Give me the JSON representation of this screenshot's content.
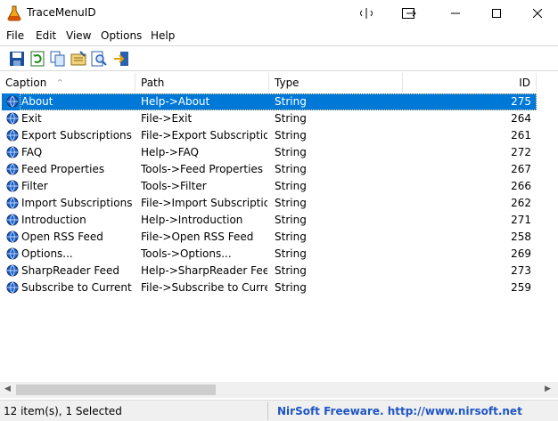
{
  "window": {
    "title": "TraceMenuID",
    "icon": "flask-icon"
  },
  "menubar": [
    "File",
    "Edit",
    "View",
    "Options",
    "Help"
  ],
  "toolbar": [
    "save-icon",
    "refresh-icon",
    "copy-icon",
    "properties-icon",
    "find-icon",
    "exit-icon"
  ],
  "columns": [
    "Caption",
    "Path",
    "Type",
    "ID"
  ],
  "rows": [
    {
      "caption": "About",
      "path": "Help->About",
      "type": "String",
      "id": "275",
      "selected": true
    },
    {
      "caption": "Exit",
      "path": "File->Exit",
      "type": "String",
      "id": "264"
    },
    {
      "caption": "Export Subscriptions",
      "path": "File->Export Subscriptio...",
      "type": "String",
      "id": "261"
    },
    {
      "caption": "FAQ",
      "path": "Help->FAQ",
      "type": "String",
      "id": "272"
    },
    {
      "caption": "Feed Properties",
      "path": "Tools->Feed Properties",
      "type": "String",
      "id": "267"
    },
    {
      "caption": "Filter",
      "path": "Tools->Filter",
      "type": "String",
      "id": "266"
    },
    {
      "caption": "Import Subscriptions",
      "path": "File->Import Subscriptio...",
      "type": "String",
      "id": "262"
    },
    {
      "caption": "Introduction",
      "path": "Help->Introduction",
      "type": "String",
      "id": "271"
    },
    {
      "caption": "Open RSS Feed",
      "path": "File->Open RSS Feed",
      "type": "String",
      "id": "258"
    },
    {
      "caption": "Options...",
      "path": "Tools->Options...",
      "type": "String",
      "id": "269"
    },
    {
      "caption": "SharpReader Feed",
      "path": "Help->SharpReader Feed",
      "type": "String",
      "id": "273"
    },
    {
      "caption": "Subscribe to Current F...",
      "path": "File->Subscribe to Curre...",
      "type": "String",
      "id": "259"
    }
  ],
  "status": {
    "items": "12 item(s), 1 Selected",
    "link": "NirSoft Freeware.  http://www.nirsoft.net"
  }
}
